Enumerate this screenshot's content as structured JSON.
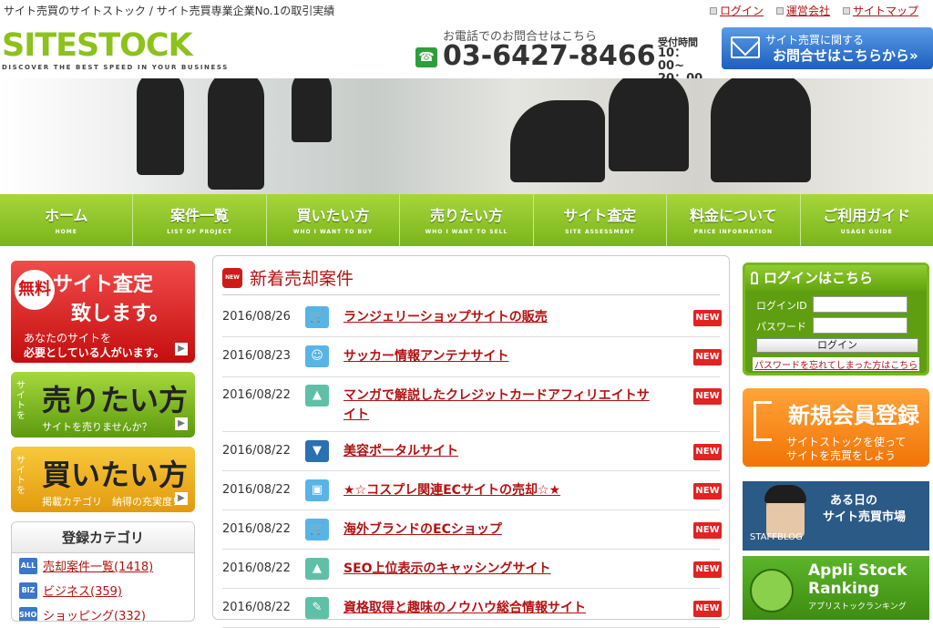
{
  "top": {
    "tagline": "サイト売買のサイトストック / サイト売買専業企業No.1の取引実績",
    "links": [
      "ログイン",
      "運営会社",
      "サイトマップ"
    ]
  },
  "header": {
    "logo": "SITESTOCK",
    "logo_sub": "DISCOVER THE BEST SPEED IN YOUR BUSINESS",
    "phone_caption": "お電話でのお問合せはこちら",
    "phone_number": "03-6427-8466",
    "hours_caption": "受付時間",
    "hours": "10：00~ 20：00",
    "contact_line1": "サイト売買に関する",
    "contact_line2": "お問合せはこちらから»"
  },
  "nav": [
    {
      "label": "ホーム",
      "sub": "HOME"
    },
    {
      "label": "案件一覧",
      "sub": "LIST OF PROJECT"
    },
    {
      "label": "買いたい方",
      "sub": "WHO I WANT TO BUY"
    },
    {
      "label": "売りたい方",
      "sub": "WHO I WANT TO SELL"
    },
    {
      "label": "サイト査定",
      "sub": "SITE ASSESSMENT"
    },
    {
      "label": "料金について",
      "sub": "PRICE INFORMATION"
    },
    {
      "label": "ご利用ガイド",
      "sub": "USAGE GUIDE"
    }
  ],
  "left": {
    "banner1": {
      "free": "無料",
      "line1": "サイト査定",
      "line2": "致します。",
      "sub1": "あなたのサイトを",
      "sub2": "必要としている人がいます。"
    },
    "banner2": {
      "vert": "サイトを",
      "big": "売りたい方",
      "small": "サイトを売りませんか？"
    },
    "banner3": {
      "vert": "サイトを",
      "big": "買いたい方",
      "small": "掲載カテゴリ　納得の充実度！"
    },
    "categories_title": "登録カテゴリ",
    "categories": [
      {
        "icon": "ALL",
        "label": "売却案件一覧(1418)"
      },
      {
        "icon": "BIZ",
        "label": "ビジネス(359)"
      },
      {
        "icon": "SHOP",
        "label": "ショッピング(332)"
      }
    ]
  },
  "main": {
    "new_icon": "NEW",
    "title": "新着売却案件",
    "listings": [
      {
        "date": "2016/08/26",
        "icon": "cart-icon",
        "title": "ランジェリーショップサイトの販売",
        "badge": "NEW"
      },
      {
        "date": "2016/08/23",
        "icon": "smiley-icon",
        "title": "サッカー情報アンテナサイト",
        "badge": "NEW"
      },
      {
        "date": "2016/08/22",
        "icon": "picture-icon",
        "title": "マンガで解説したクレジットカードアフィリエイトサイト",
        "badge": "NEW"
      },
      {
        "date": "2016/08/22",
        "icon": "dress-icon",
        "title": "美容ポータルサイト",
        "badge": "NEW"
      },
      {
        "date": "2016/08/22",
        "icon": "suitcase-icon",
        "title": "★☆コスプレ関連ECサイトの売却☆★",
        "badge": "NEW"
      },
      {
        "date": "2016/08/22",
        "icon": "cart-icon",
        "title": "海外ブランドのECショップ",
        "badge": "NEW"
      },
      {
        "date": "2016/08/22",
        "icon": "picture-icon",
        "title": "SEO上位表示のキャッシングサイト",
        "badge": "NEW"
      },
      {
        "date": "2016/08/22",
        "icon": "pencil-icon",
        "title": "資格取得と趣味のノウハウ総合情報サイト",
        "badge": "NEW"
      }
    ]
  },
  "right": {
    "login_title": "ログインはこちら",
    "login_id_label": "ログインID",
    "password_label": "パスワード",
    "login_button": "ログイン",
    "forgot": "パスワードを忘れてしまった方はこちら",
    "register_big": "新規会員登録",
    "register_sub1": "サイトストックを使って",
    "register_sub2": "サイトを売買をしよう",
    "staff_line1": "ある日の",
    "staff_line2": "サイト売買市場",
    "staff_label": "STAFFBLOG",
    "appli_line1": "Appli Stock",
    "appli_line2": "Ranking",
    "appli_line3": "アプリストックランキング"
  }
}
